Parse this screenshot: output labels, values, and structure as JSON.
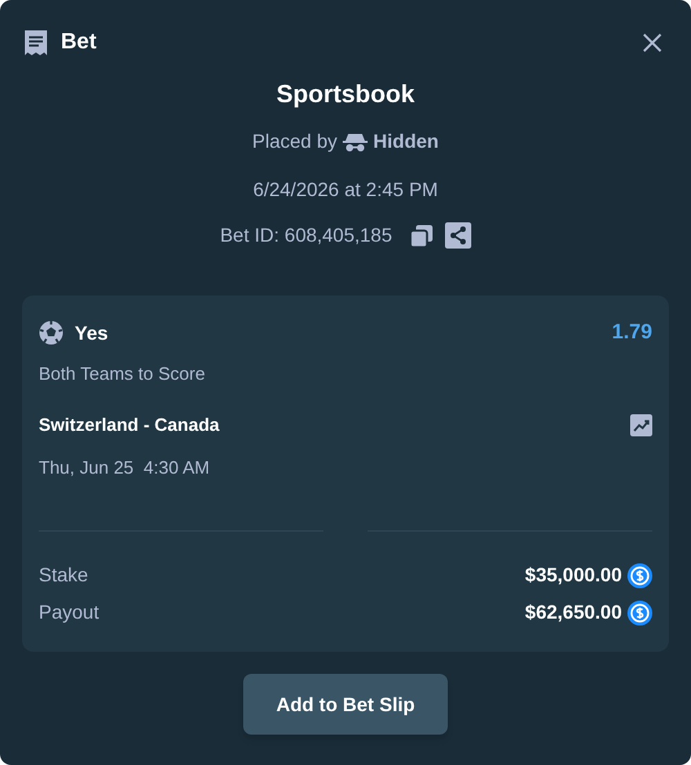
{
  "dialog": {
    "title": "Bet"
  },
  "summary": {
    "title": "Sportsbook",
    "placed_by_label": "Placed by",
    "placed_by_user": "Hidden",
    "datetime": "6/24/2026 at 2:45 PM",
    "bet_id": "Bet ID: 608,405,185"
  },
  "selection": {
    "outcome": "Yes",
    "odds": "1.79",
    "market": "Both Teams to Score",
    "event": "Switzerland - Canada",
    "start_time": "Thu, Jun 25  4:30 AM"
  },
  "totals": [
    {
      "label": "Stake",
      "amount": "$35,000.00"
    },
    {
      "label": "Payout",
      "amount": "$62,650.00"
    }
  ],
  "button": "Add to Bet Slip"
}
